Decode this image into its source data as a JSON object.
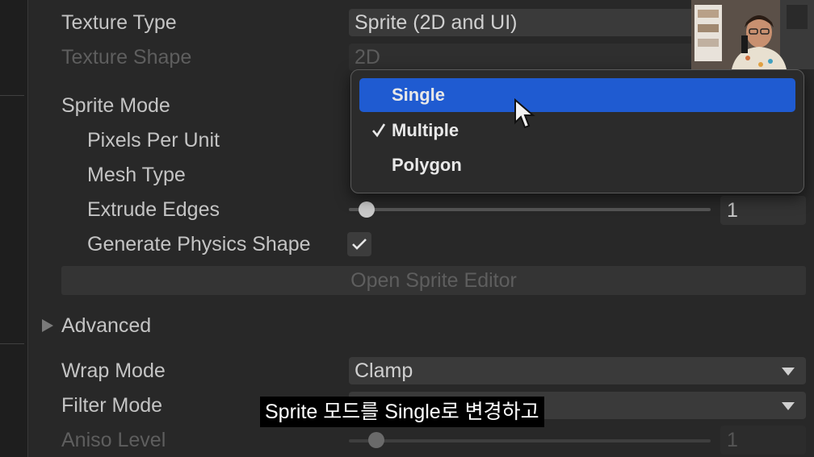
{
  "inspector": {
    "texture_type": {
      "label": "Texture Type",
      "value": "Sprite (2D and UI)"
    },
    "texture_shape": {
      "label": "Texture Shape",
      "value": "2D"
    },
    "sprite_mode": {
      "label": "Sprite Mode"
    },
    "pixels_per_unit": {
      "label": "Pixels Per Unit"
    },
    "mesh_type": {
      "label": "Mesh Type"
    },
    "extrude_edges": {
      "label": "Extrude Edges",
      "value": "1"
    },
    "generate_physics_shape": {
      "label": "Generate Physics Shape",
      "checked": true
    },
    "open_sprite_editor": {
      "label": "Open Sprite Editor"
    },
    "advanced": {
      "label": "Advanced"
    },
    "wrap_mode": {
      "label": "Wrap Mode",
      "value": "Clamp"
    },
    "filter_mode": {
      "label": "Filter Mode"
    },
    "aniso_level": {
      "label": "Aniso Level",
      "value": "1"
    }
  },
  "dropdown": {
    "items": [
      {
        "label": "Single",
        "highlighted": true,
        "checked": false
      },
      {
        "label": "Multiple",
        "highlighted": false,
        "checked": true
      },
      {
        "label": "Polygon",
        "highlighted": false,
        "checked": false
      }
    ]
  },
  "subtitle": "Sprite 모드를 Single로 변경하고",
  "colors": {
    "selection": "#1f5bd1",
    "panel": "#282828"
  },
  "icons": {
    "checkmark": "checkmark-icon",
    "caret": "chevron-down-icon",
    "foldout": "triangle-right-icon",
    "cursor": "mouse-pointer-icon"
  }
}
